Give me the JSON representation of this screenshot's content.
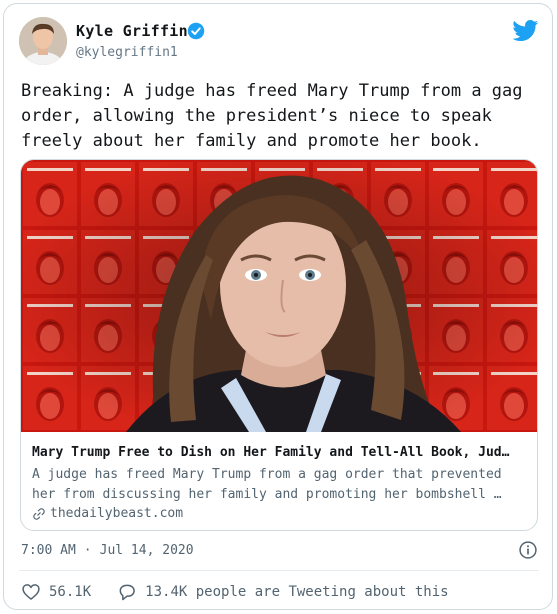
{
  "author": {
    "name": "Kyle Griffin",
    "handle": "@kylegriffin1",
    "verified": true
  },
  "tweet_text": "Breaking: A judge has freed Mary Trump from a gag order, allowing the president’s niece to speak freely about her family and promote her book.",
  "card": {
    "title": "Mary Trump Free to Dish on Her Family and Tell-All Book, Jud…",
    "description": "A judge has freed Mary Trump from a gag order that prevented her from discussing her family and promoting her bombshell …",
    "domain": "thedailybeast.com"
  },
  "meta": {
    "time": "7:00 AM",
    "separator": "·",
    "date": "Jul 14, 2020"
  },
  "actions": {
    "likes": "56.1K",
    "tweeting": "13.4K people are Tweeting about this"
  },
  "icons": {
    "brand": "twitter-bird-icon",
    "verified": "verified-badge-icon",
    "link": "link-icon",
    "info": "info-icon",
    "like": "heart-icon",
    "reply": "speech-bubble-icon"
  },
  "colors": {
    "twitter_blue": "#1da1f2",
    "card_background": "#d8251a",
    "text_secondary": "#536471"
  }
}
